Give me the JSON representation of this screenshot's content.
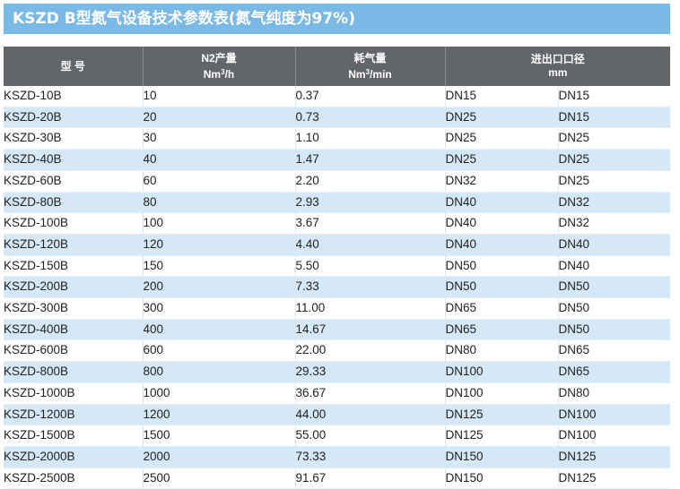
{
  "title": "KSZD B型氮气设备技术参数表(氮气纯度为97%)",
  "headers": {
    "model": "型 号",
    "n2_output_line1": "N2产量",
    "n2_output_unit_base": "Nm",
    "n2_output_unit_sup": "3",
    "n2_output_unit_tail": "/h",
    "air_consumption_line1": "耗气量",
    "air_consumption_unit_base": "Nm",
    "air_consumption_unit_sup": "3",
    "air_consumption_unit_tail": "/min",
    "ports_line1": "进出口口径",
    "ports_unit": "mm"
  },
  "rows": [
    {
      "model": "KSZD-10B",
      "n2": "10",
      "air": "0.37",
      "inlet": "DN15",
      "outlet": "DN15"
    },
    {
      "model": "KSZD-20B",
      "n2": "20",
      "air": "0.73",
      "inlet": "DN25",
      "outlet": "DN15"
    },
    {
      "model": "KSZD-30B",
      "n2": "30",
      "air": "1.10",
      "inlet": "DN25",
      "outlet": "DN25"
    },
    {
      "model": "KSZD-40B",
      "n2": "40",
      "air": "1.47",
      "inlet": "DN25",
      "outlet": "DN25"
    },
    {
      "model": "KSZD-60B",
      "n2": "60",
      "air": "2.20",
      "inlet": "DN32",
      "outlet": "DN25"
    },
    {
      "model": "KSZD-80B",
      "n2": "80",
      "air": "2.93",
      "inlet": "DN40",
      "outlet": "DN32"
    },
    {
      "model": "KSZD-100B",
      "n2": "100",
      "air": "3.67",
      "inlet": "DN40",
      "outlet": "DN32"
    },
    {
      "model": "KSZD-120B",
      "n2": "120",
      "air": "4.40",
      "inlet": "DN40",
      "outlet": "DN40"
    },
    {
      "model": "KSZD-150B",
      "n2": "150",
      "air": "5.50",
      "inlet": "DN50",
      "outlet": "DN40"
    },
    {
      "model": "KSZD-200B",
      "n2": "200",
      "air": "7.33",
      "inlet": "DN50",
      "outlet": "DN50"
    },
    {
      "model": "KSZD-300B",
      "n2": "300",
      "air": "11.00",
      "inlet": "DN65",
      "outlet": "DN50"
    },
    {
      "model": "KSZD-400B",
      "n2": "400",
      "air": "14.67",
      "inlet": "DN65",
      "outlet": "DN50"
    },
    {
      "model": "KSZD-600B",
      "n2": "600",
      "air": "22.00",
      "inlet": "DN80",
      "outlet": "DN65"
    },
    {
      "model": "KSZD-800B",
      "n2": "800",
      "air": "29.33",
      "inlet": "DN100",
      "outlet": "DN65"
    },
    {
      "model": "KSZD-1000B",
      "n2": "1000",
      "air": "36.67",
      "inlet": "DN100",
      "outlet": "DN80"
    },
    {
      "model": "KSZD-1200B",
      "n2": "1200",
      "air": "44.00",
      "inlet": "DN125",
      "outlet": "DN100"
    },
    {
      "model": "KSZD-1500B",
      "n2": "1500",
      "air": "55.00",
      "inlet": "DN125",
      "outlet": "DN100"
    },
    {
      "model": "KSZD-2000B",
      "n2": "2000",
      "air": "73.33",
      "inlet": "DN150",
      "outlet": "DN125"
    },
    {
      "model": "KSZD-2500B",
      "n2": "2500",
      "air": "91.67",
      "inlet": "DN150",
      "outlet": "DN125"
    }
  ],
  "colors": {
    "title_bg": "#7ab8e5",
    "header_bg": "#626569",
    "row_alt_bg": "#d5e8f7"
  }
}
